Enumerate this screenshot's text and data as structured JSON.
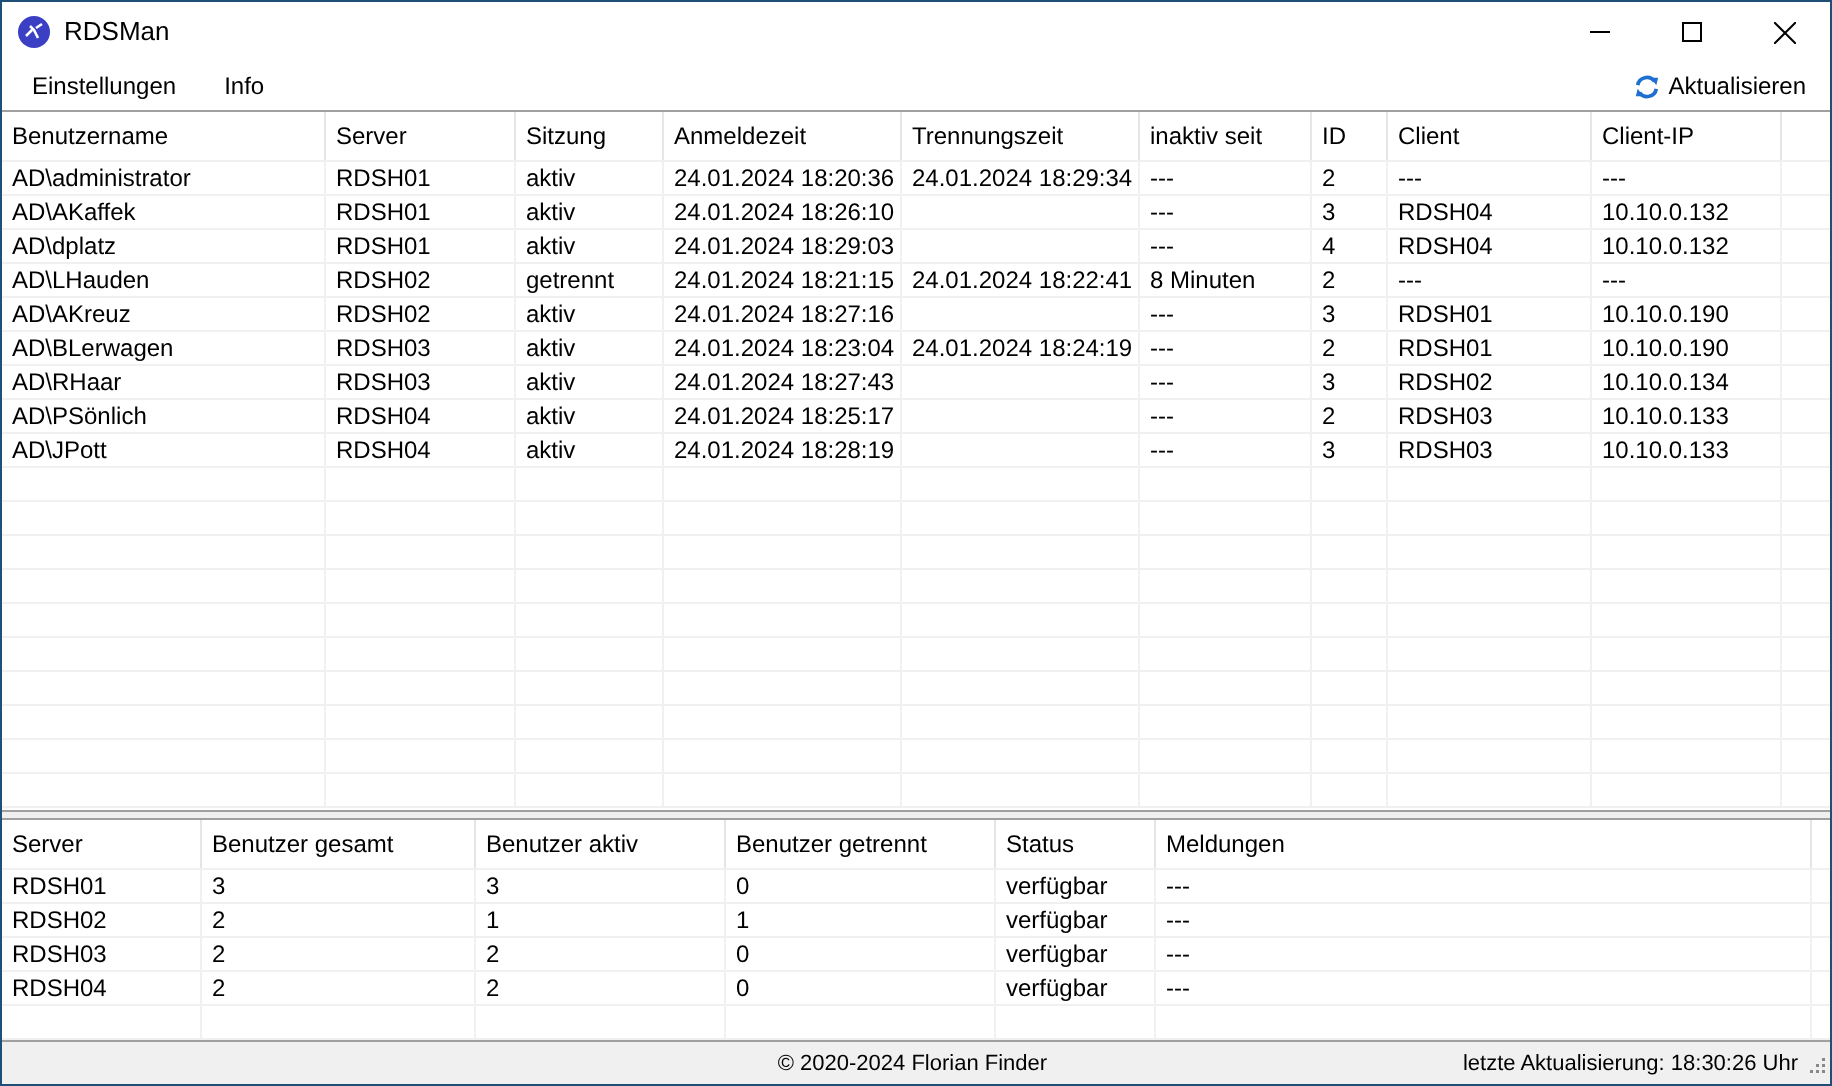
{
  "window": {
    "title": "RDSMan"
  },
  "menu": [
    "Einstellungen",
    "Info"
  ],
  "refresh_button": "Aktualisieren",
  "sessions": {
    "columns": [
      "Benutzername",
      "Server",
      "Sitzung",
      "Anmeldezeit",
      "Trennungszeit",
      "inaktiv seit",
      "ID",
      "Client",
      "Client-IP"
    ],
    "rows": [
      [
        "AD\\administrator",
        "RDSH01",
        "aktiv",
        "24.01.2024 18:20:36",
        "24.01.2024 18:29:34",
        "---",
        "2",
        "---",
        "---"
      ],
      [
        "AD\\AKaffek",
        "RDSH01",
        "aktiv",
        "24.01.2024 18:26:10",
        "",
        "---",
        "3",
        "RDSH04",
        "10.10.0.132"
      ],
      [
        "AD\\dplatz",
        "RDSH01",
        "aktiv",
        "24.01.2024 18:29:03",
        "",
        "---",
        "4",
        "RDSH04",
        "10.10.0.132"
      ],
      [
        "AD\\LHauden",
        "RDSH02",
        "getrennt",
        "24.01.2024 18:21:15",
        "24.01.2024 18:22:41",
        "8 Minuten",
        "2",
        "---",
        "---"
      ],
      [
        "AD\\AKreuz",
        "RDSH02",
        "aktiv",
        "24.01.2024 18:27:16",
        "",
        "---",
        "3",
        "RDSH01",
        "10.10.0.190"
      ],
      [
        "AD\\BLerwagen",
        "RDSH03",
        "aktiv",
        "24.01.2024 18:23:04",
        "24.01.2024 18:24:19",
        "---",
        "2",
        "RDSH01",
        "10.10.0.190"
      ],
      [
        "AD\\RHaar",
        "RDSH03",
        "aktiv",
        "24.01.2024 18:27:43",
        "",
        "---",
        "3",
        "RDSH02",
        "10.10.0.134"
      ],
      [
        "AD\\PSönlich",
        "RDSH04",
        "aktiv",
        "24.01.2024 18:25:17",
        "",
        "---",
        "2",
        "RDSH03",
        "10.10.0.133"
      ],
      [
        "AD\\JPott",
        "RDSH04",
        "aktiv",
        "24.01.2024 18:28:19",
        "",
        "---",
        "3",
        "RDSH03",
        "10.10.0.133"
      ]
    ]
  },
  "servers": {
    "columns": [
      "Server",
      "Benutzer gesamt",
      "Benutzer aktiv",
      "Benutzer getrennt",
      "Status",
      "Meldungen"
    ],
    "rows": [
      [
        "RDSH01",
        "3",
        "3",
        "0",
        "verfügbar",
        "---"
      ],
      [
        "RDSH02",
        "2",
        "1",
        "1",
        "verfügbar",
        "---"
      ],
      [
        "RDSH03",
        "2",
        "2",
        "0",
        "verfügbar",
        "---"
      ],
      [
        "RDSH04",
        "2",
        "2",
        "0",
        "verfügbar",
        "---"
      ]
    ]
  },
  "status_bar": {
    "copyright": "© 2020-2024 Florian Finder",
    "last_update": "letzte Aktualisierung: 18:30:26 Uhr"
  }
}
